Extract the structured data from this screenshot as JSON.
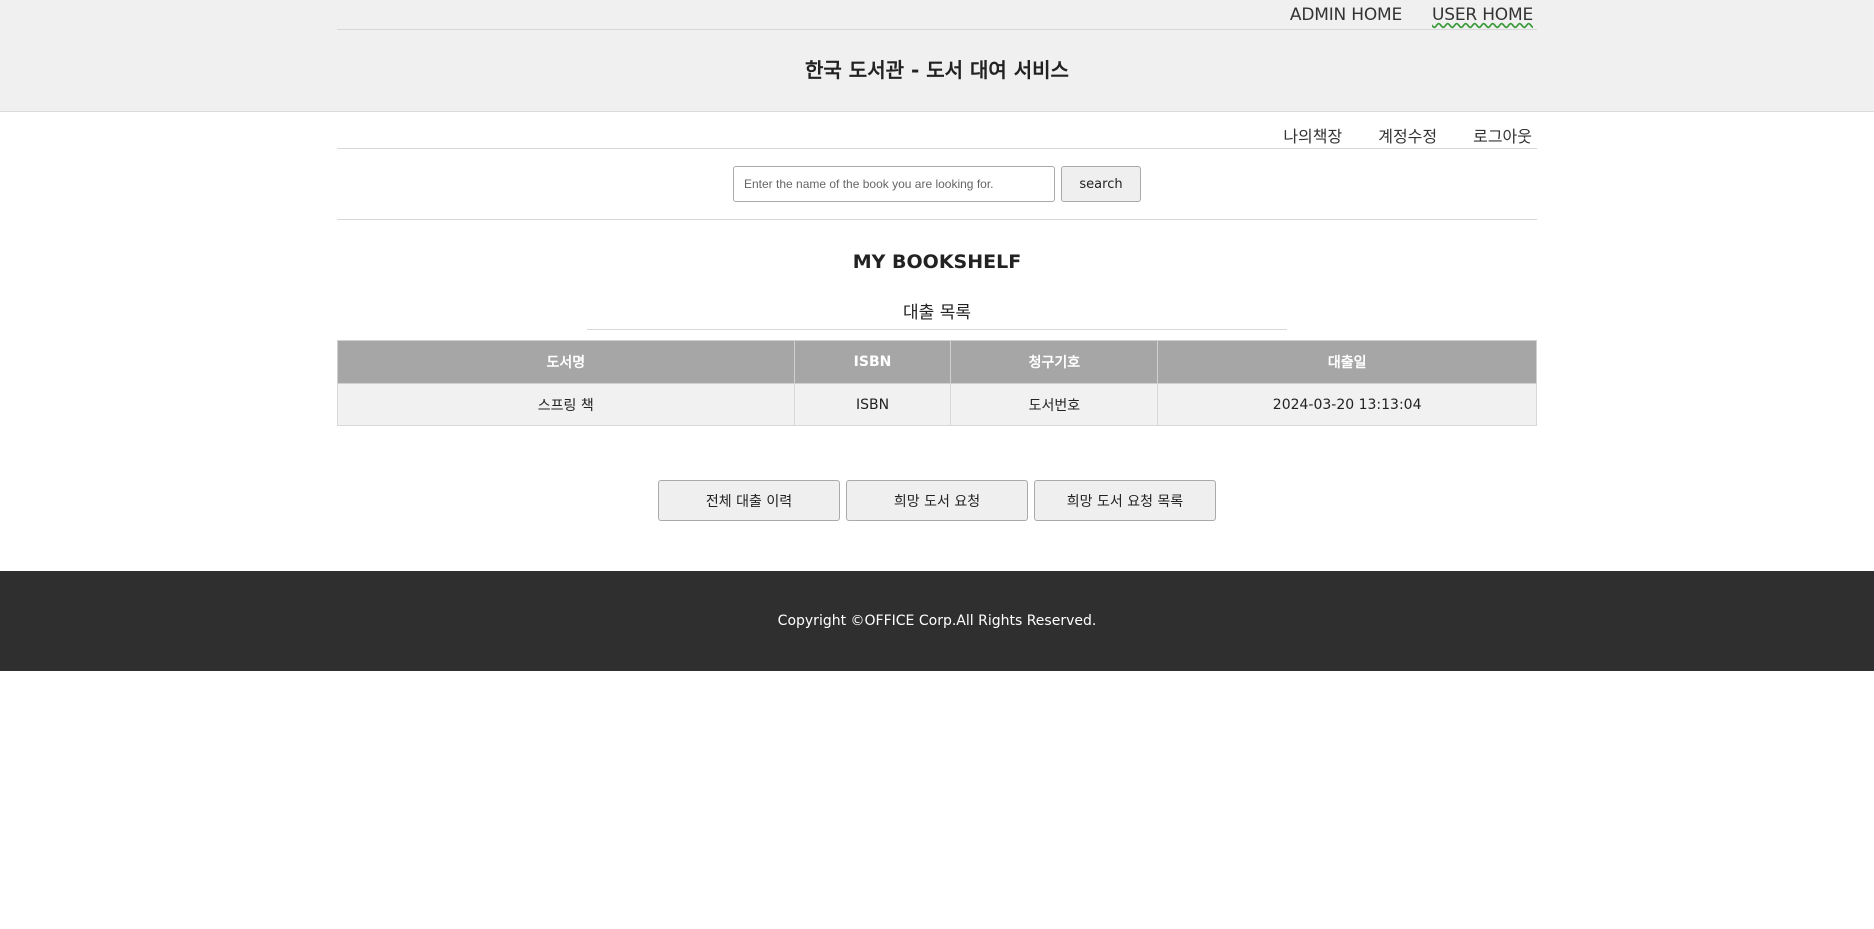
{
  "top_nav": {
    "admin_home": "ADMIN HOME",
    "user_home": "USER HOME"
  },
  "header": {
    "title": "한국 도서관 - 도서 대여 서비스"
  },
  "user_nav": {
    "items": [
      "나의책장",
      "계정수정",
      "로그아웃"
    ]
  },
  "search": {
    "placeholder": "Enter the name of the book you are looking for.",
    "button_label": "search"
  },
  "main": {
    "page_title": "MY BOOKSHELF",
    "section_title": "대출 목록",
    "table": {
      "columns": [
        "도서명",
        "ISBN",
        "청구기호",
        "대출일"
      ],
      "rows": [
        [
          "스프링 책",
          "ISBN",
          "도서번호",
          "2024-03-20 13:13:04"
        ]
      ]
    },
    "actions": [
      "전체 대출 이력",
      "희망 도서 요청",
      "희망 도서 요청 목록"
    ]
  },
  "footer": {
    "copyright": "Copyright ©OFFICE Corp.All Rights Reserved."
  },
  "colors": {
    "header_background": "#f0f0f0",
    "table_header": "#a6a6a6",
    "footer_background": "#2f2f2f"
  }
}
